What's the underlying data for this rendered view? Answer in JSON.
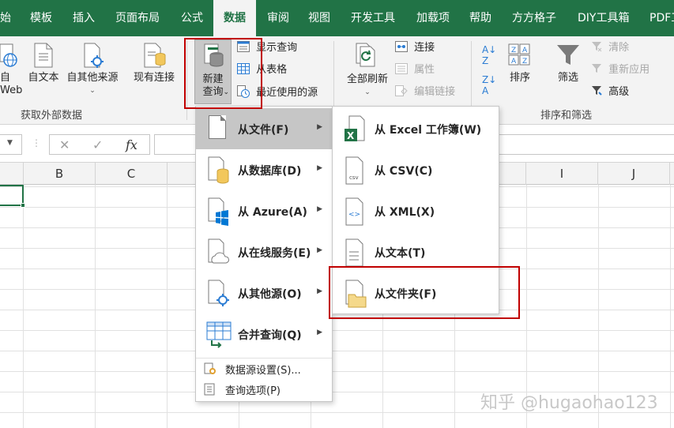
{
  "tabs": [
    {
      "label": "始"
    },
    {
      "label": "模板"
    },
    {
      "label": "插入"
    },
    {
      "label": "页面布局"
    },
    {
      "label": "公式"
    },
    {
      "label": "数据"
    },
    {
      "label": "审阅"
    },
    {
      "label": "视图"
    },
    {
      "label": "开发工具"
    },
    {
      "label": "加载项"
    },
    {
      "label": "帮助"
    },
    {
      "label": "方方格子"
    },
    {
      "label": "DIY工具箱"
    },
    {
      "label": "PDF工"
    }
  ],
  "ribbon": {
    "from_web": {
      "line1": "自",
      "line2": "Web"
    },
    "from_text": "自文本",
    "from_other": "自其他来源",
    "existing_conn": "现有连接",
    "new_query": {
      "line1": "新建",
      "line2": "查询"
    },
    "show_query": "显示查询",
    "from_table": "从表格",
    "recent_sources": "最近使用的源",
    "refresh_all": "全部刷新",
    "connections": "连接",
    "properties": "属性",
    "edit_links": "编辑链接",
    "sort": "排序",
    "filter": "筛选",
    "clear": "清除",
    "reapply": "重新应用",
    "advanced": "高级",
    "group_external": "获取外部数据",
    "group_sort_filter": "排序和筛选"
  },
  "formula_bar": {
    "cancel": "✕",
    "enter": "✓",
    "fx": "fx"
  },
  "columns": [
    "B",
    "C",
    "I",
    "J"
  ],
  "menu": {
    "from_file": "从文件(F)",
    "from_db": "从数据库(D)",
    "from_azure": "从 Azure(A)",
    "from_online": "从在线服务(E)",
    "from_other": "从其他源(O)",
    "combine": "合并查询(Q)",
    "ds_settings": "数据源设置(S)...",
    "query_options": "查询选项(P)"
  },
  "submenu": {
    "excel": "从 Excel 工作簿(W)",
    "csv": "从 CSV(C)",
    "xml": "从 XML(X)",
    "text": "从文本(T)",
    "folder": "从文件夹(F)"
  },
  "watermark": "知乎 @hugaohao123",
  "colors": {
    "accent": "#217346",
    "highlight": "#c00000"
  }
}
